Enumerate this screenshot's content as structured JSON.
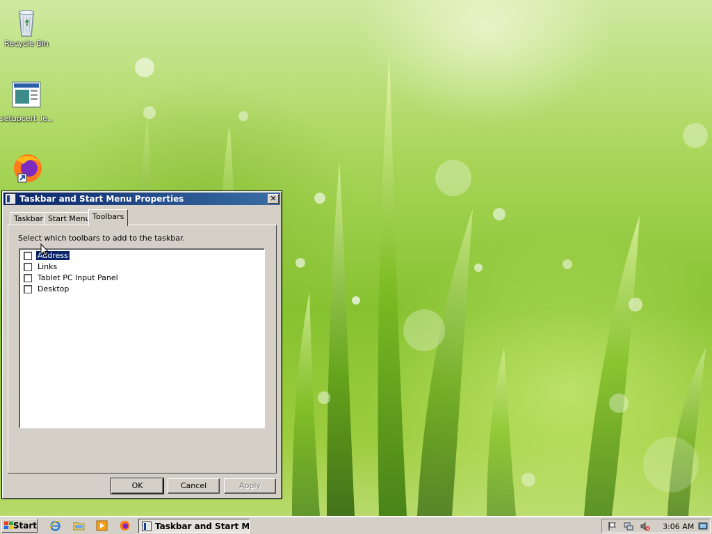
{
  "desktop": {
    "icons": [
      {
        "label": "Recycle Bin"
      },
      {
        "label": "setupcert_le..."
      },
      {
        "label": ""
      }
    ]
  },
  "dialog": {
    "title": "Taskbar and Start Menu Properties",
    "close_glyph": "✕",
    "tabs": [
      {
        "label": "Taskbar"
      },
      {
        "label": "Start Menu"
      },
      {
        "label": "Toolbars",
        "active": true
      }
    ],
    "instruction": "Select which toolbars to add to the taskbar.",
    "toolbars": [
      {
        "label": "Address",
        "checked": false,
        "selected": true
      },
      {
        "label": "Links",
        "checked": false
      },
      {
        "label": "Tablet PC Input Panel",
        "checked": false
      },
      {
        "label": "Desktop",
        "checked": false
      }
    ],
    "buttons": {
      "ok": "OK",
      "cancel": "Cancel",
      "apply": "Apply"
    }
  },
  "taskbar": {
    "start_label": "Start",
    "quick_launch": [
      "ie-icon",
      "explorer-icon",
      "media-player-icon",
      "firefox-icon"
    ],
    "active_task": "Taskbar and Start Me...",
    "tray_icons": [
      "flag-icon",
      "network-icon",
      "volume-muted-icon"
    ],
    "clock": "3:06 AM"
  },
  "colors": {
    "titlebar_start": "#0a246a",
    "titlebar_end": "#3a6ea5",
    "face": "#d4d0c8",
    "selection": "#0a246a"
  }
}
